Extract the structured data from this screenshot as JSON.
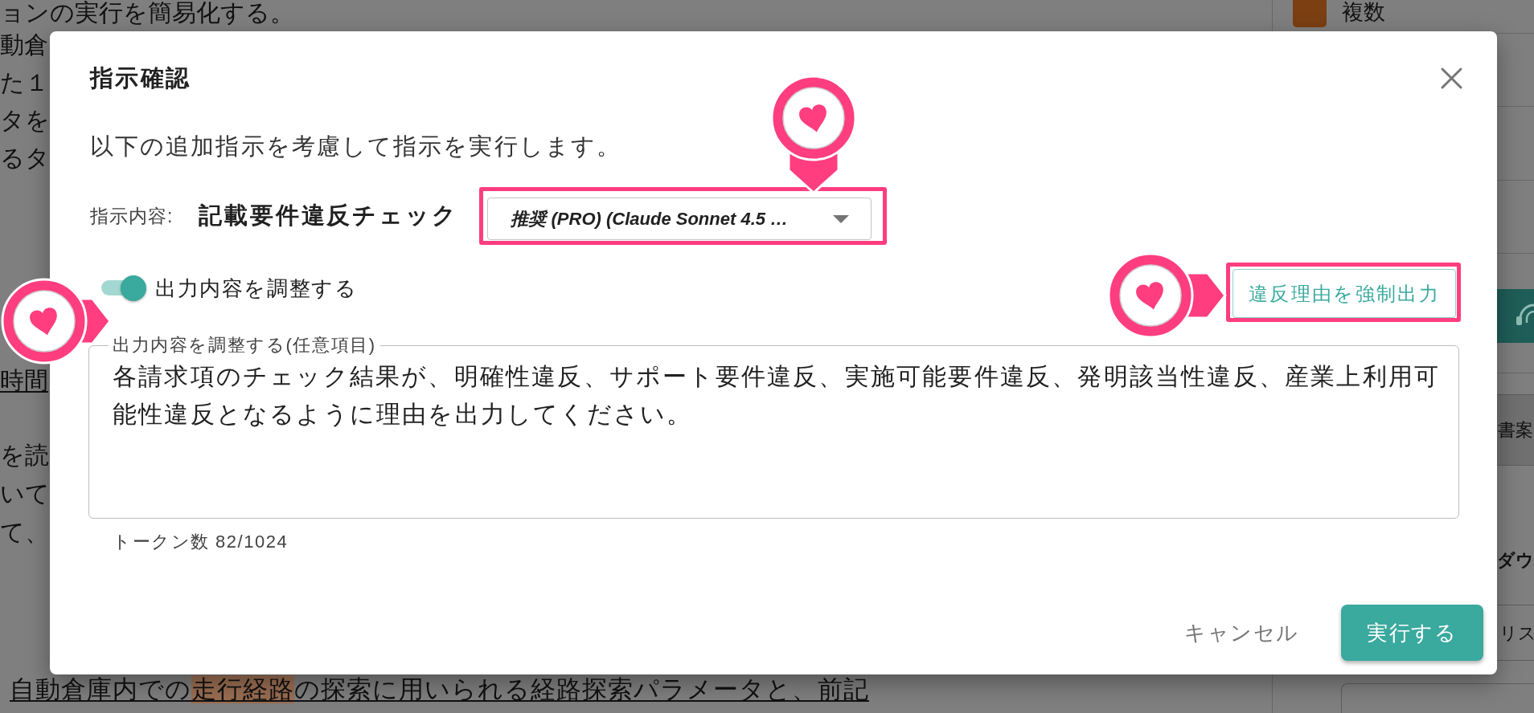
{
  "background": {
    "document": {
      "blocks": [
        {
          "lines": [
            {
              "underlined": false,
              "segments": [
                {
                  "text": "ョンの実行を簡易化する。",
                  "highlighted": false
                }
              ]
            },
            {
              "underlined": false,
              "segments": [
                {
                  "text": "動倉",
                  "highlighted": false
                }
              ]
            },
            {
              "underlined": false,
              "segments": [
                {
                  "text": "た１",
                  "highlighted": false
                }
              ]
            },
            {
              "underlined": false,
              "segments": [
                {
                  "text": "タを",
                  "highlighted": false
                }
              ]
            },
            {
              "underlined": false,
              "segments": [
                {
                  "text": "るタ",
                  "highlighted": false
                }
              ]
            }
          ]
        },
        {
          "lines": [
            {
              "underlined": true,
              "segments": [
                {
                  "text": "時間",
                  "highlighted": false
                }
              ]
            }
          ]
        },
        {
          "lines": [
            {
              "underlined": false,
              "segments": [
                {
                  "text": "を読",
                  "highlighted": false
                }
              ]
            },
            {
              "underlined": false,
              "segments": [
                {
                  "text": "いて",
                  "highlighted": false
                }
              ]
            },
            {
              "underlined": false,
              "segments": [
                {
                  "text": "て、",
                  "highlighted": false
                }
              ]
            }
          ]
        },
        {
          "lines": [
            {
              "underlined": true,
              "segments": [
                {
                  "text": "自動倉庫内での",
                  "highlighted": false
                },
                {
                  "text": "走行経路",
                  "highlighted": true
                },
                {
                  "text": "の探索に用いられる経路探索パラメータと、前記",
                  "highlighted": false
                }
              ]
            }
          ]
        }
      ]
    },
    "side_panel": {
      "legend": {
        "label": "複数",
        "color": "#7b3f12"
      },
      "items": [
        {
          "kind": "icon_button"
        },
        {
          "kind": "button",
          "label": "書案"
        },
        {
          "kind": "heading",
          "label": "ダウ"
        },
        {
          "kind": "field",
          "label": "リス"
        },
        {
          "kind": "outlined_button"
        }
      ]
    }
  },
  "dialog": {
    "title": "指示確認",
    "description": "以下の追加指示を考慮して指示を実行します。",
    "instruction": {
      "label": "指示内容:",
      "name": "記載要件違反チェック"
    },
    "model_select": {
      "value": "推奨 (PRO) (Claude Sonnet 4.5 …",
      "marked": true
    },
    "adjust_toggle": {
      "label": "出力内容を調整する",
      "on": true
    },
    "force_button": {
      "label": "違反理由を強制出力",
      "marked": true
    },
    "adjust_field": {
      "label": "出力内容を調整する(任意項目)",
      "value": "各請求項のチェック結果が、明確性違反、サポート要件違反、実施可能要件違反、発明該当性違反、産業上利用可能性違反となるように理由を出力してください。",
      "marked": true
    },
    "token_count": "トークン数 82/1024",
    "buttons": [
      {
        "label": "キャンセル",
        "kind": "text"
      },
      {
        "label": "実行する",
        "kind": "primary"
      }
    ]
  }
}
